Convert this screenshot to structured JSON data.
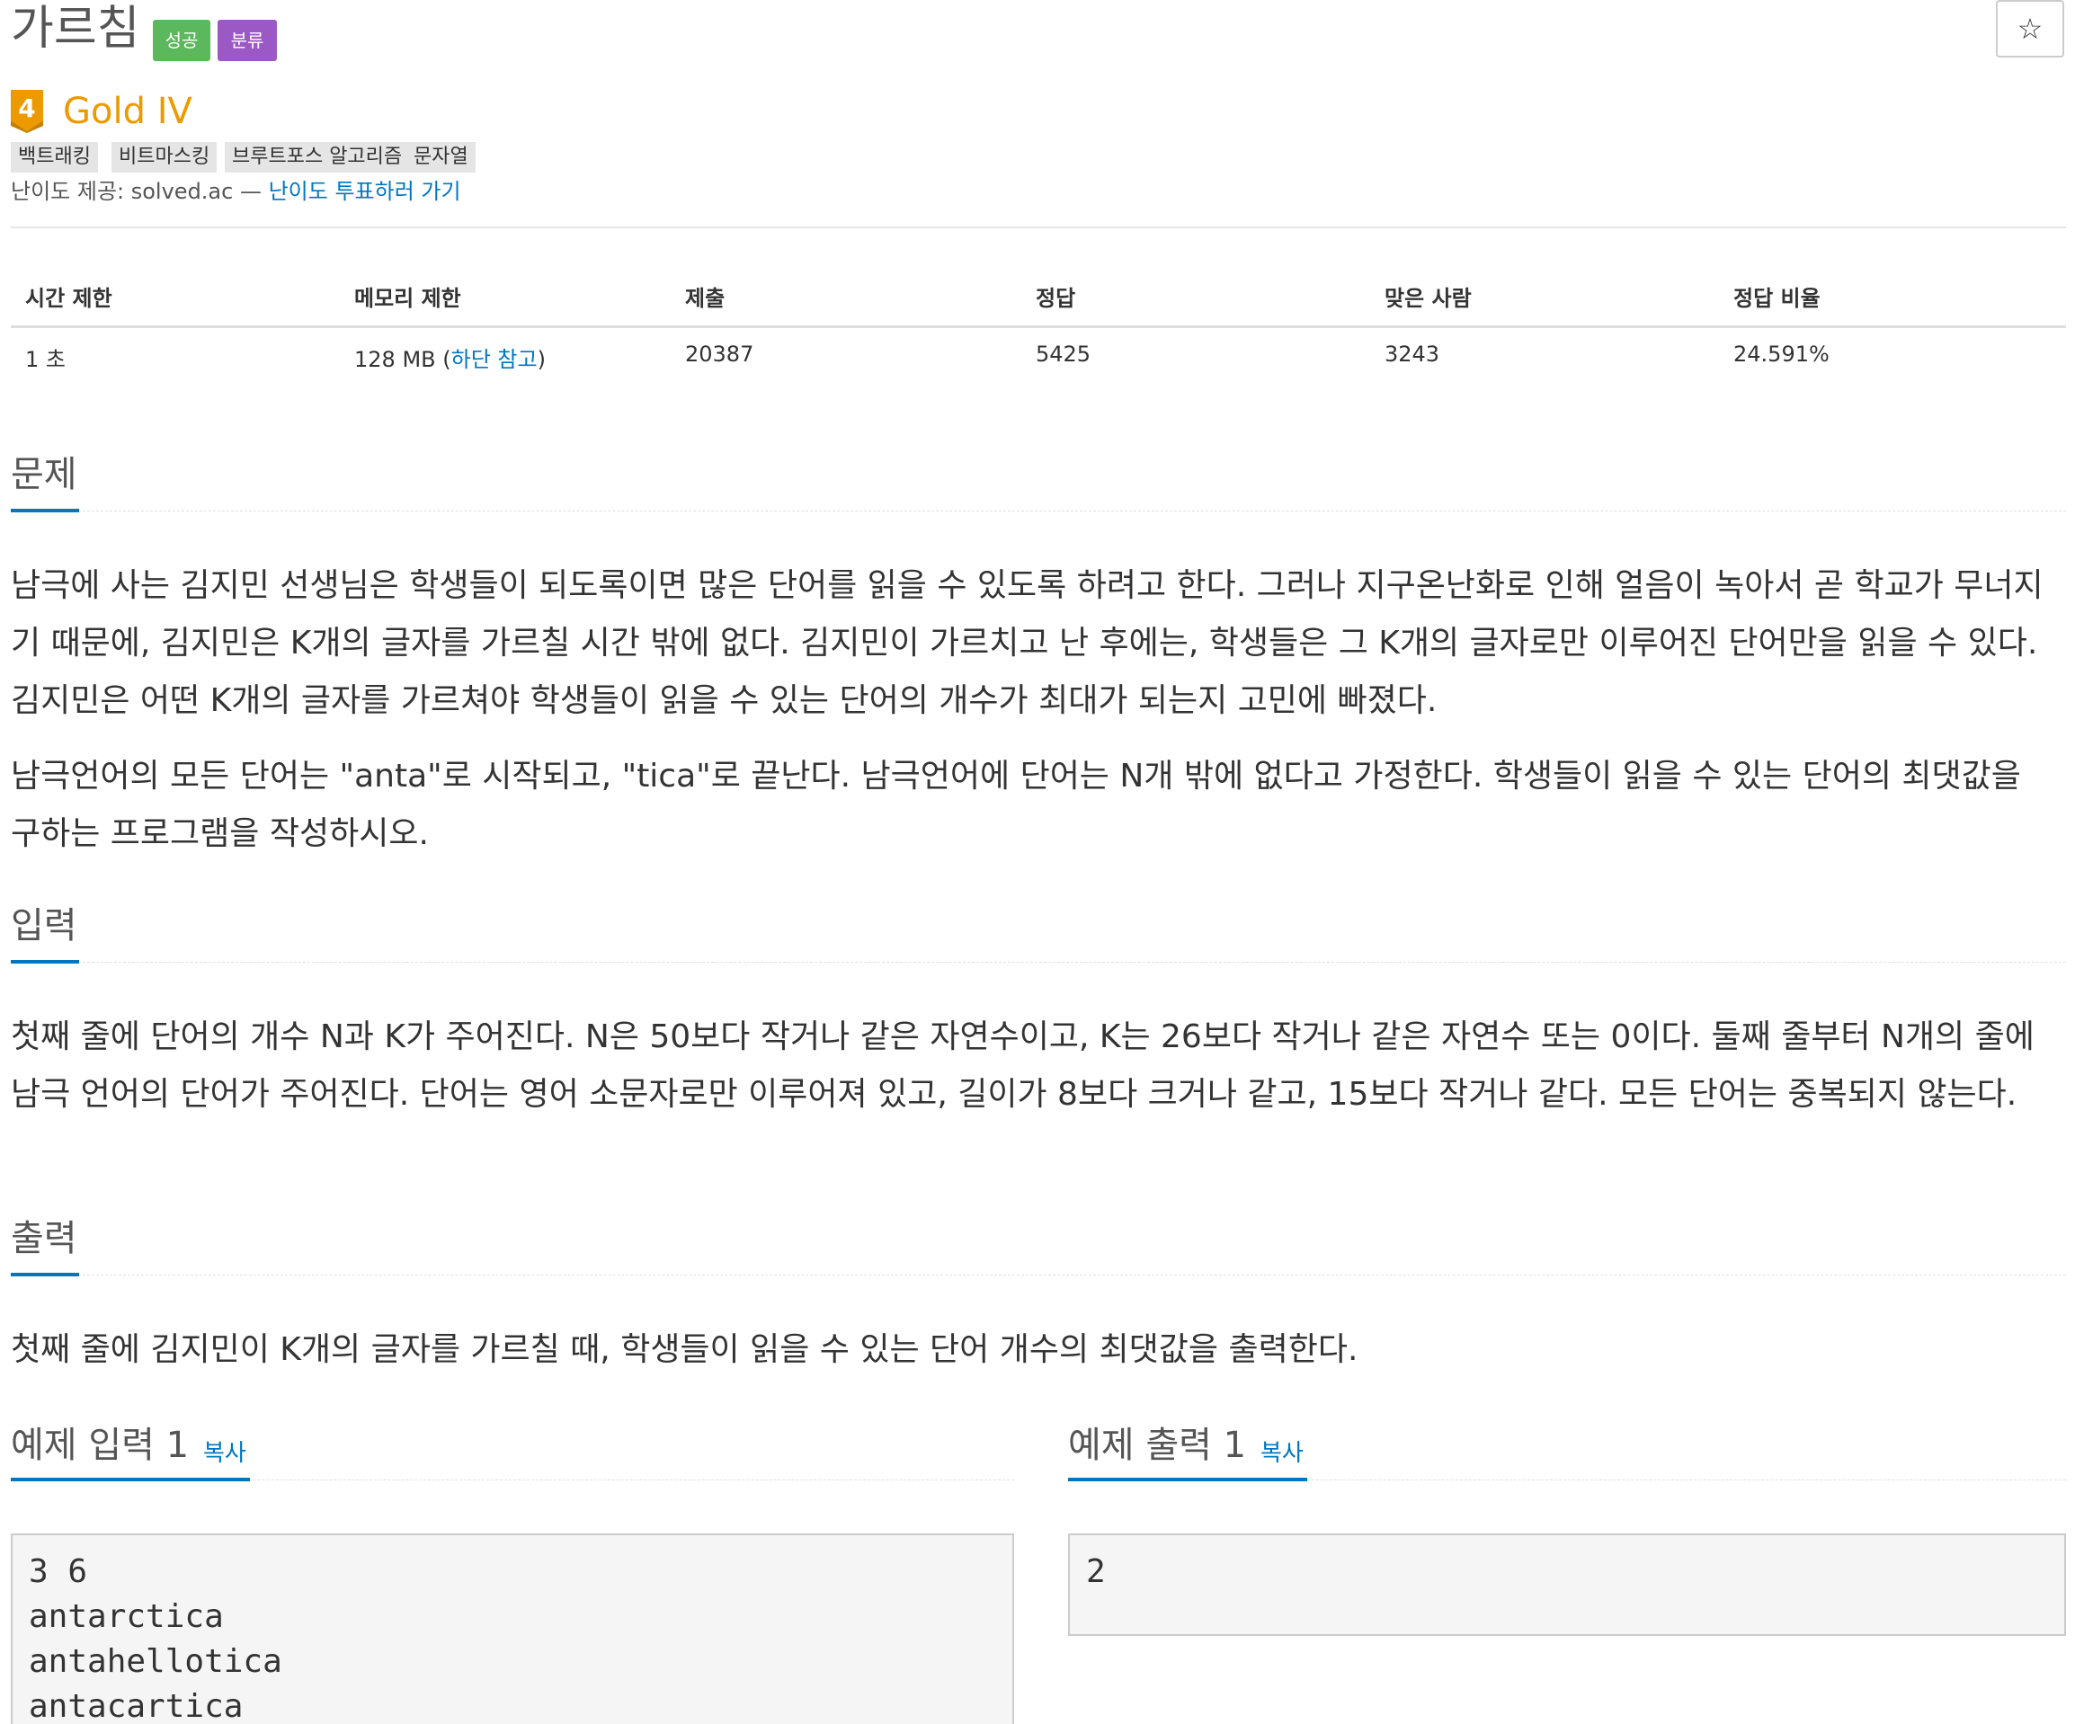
{
  "problem": {
    "title": "가르침",
    "labels": {
      "success": "성공",
      "category": "분류"
    },
    "star_icon": "☆",
    "tier": {
      "badge_number": "4",
      "name": "Gold IV",
      "color": "#ec9a00"
    },
    "tags": [
      "백트래킹",
      "비트마스킹",
      "브루트포스 알고리즘",
      "문자열"
    ],
    "difficulty_source": {
      "prefix": "난이도 제공: solved.ac — ",
      "link": "난이도 투표하러 가기"
    }
  },
  "info_table": {
    "headers": [
      "시간 제한",
      "메모리 제한",
      "제출",
      "정답",
      "맞은 사람",
      "정답 비율"
    ],
    "row": {
      "time": "1 초",
      "memory_value": "128 MB (",
      "memory_link": "하단 참고",
      "memory_suffix": ")",
      "submissions": "20387",
      "accepted": "5425",
      "solvers": "3243",
      "ratio": "24.591%"
    }
  },
  "sections": {
    "description": {
      "title": "문제",
      "paragraphs": [
        "남극에 사는 김지민 선생님은 학생들이 되도록이면 많은 단어를 읽을 수 있도록 하려고 한다. 그러나 지구온난화로 인해 얼음이 녹아서 곧 학교가 무너지기 때문에, 김지민은 K개의 글자를 가르칠 시간 밖에 없다. 김지민이 가르치고 난 후에는, 학생들은 그 K개의 글자로만 이루어진 단어만을 읽을 수 있다. 김지민은 어떤 K개의 글자를 가르쳐야 학생들이 읽을 수 있는 단어의 개수가 최대가 되는지 고민에 빠졌다.",
        "남극언어의 모든 단어는 \"anta\"로 시작되고, \"tica\"로 끝난다. 남극언어에 단어는 N개 밖에 없다고 가정한다. 학생들이 읽을 수 있는 단어의 최댓값을 구하는 프로그램을 작성하시오."
      ]
    },
    "input": {
      "title": "입력",
      "text": "첫째 줄에 단어의 개수 N과 K가 주어진다. N은 50보다 작거나 같은 자연수이고, K는 26보다 작거나 같은 자연수 또는 0이다. 둘째 줄부터 N개의 줄에 남극 언어의 단어가 주어진다. 단어는 영어 소문자로만 이루어져 있고, 길이가 8보다 크거나 같고, 15보다 작거나 같다. 모든 단어는 중복되지 않는다."
    },
    "output": {
      "title": "출력",
      "text": "첫째 줄에 김지민이 K개의 글자를 가르칠 때, 학생들이 읽을 수 있는 단어 개수의 최댓값을 출력한다."
    }
  },
  "samples": {
    "input": {
      "title": "예제 입력 1",
      "copy": "복사",
      "content": "3 6\nantarctica\nantahellotica\nantacartica"
    },
    "output": {
      "title": "예제 출력 1",
      "copy": "복사",
      "content": "2"
    }
  }
}
